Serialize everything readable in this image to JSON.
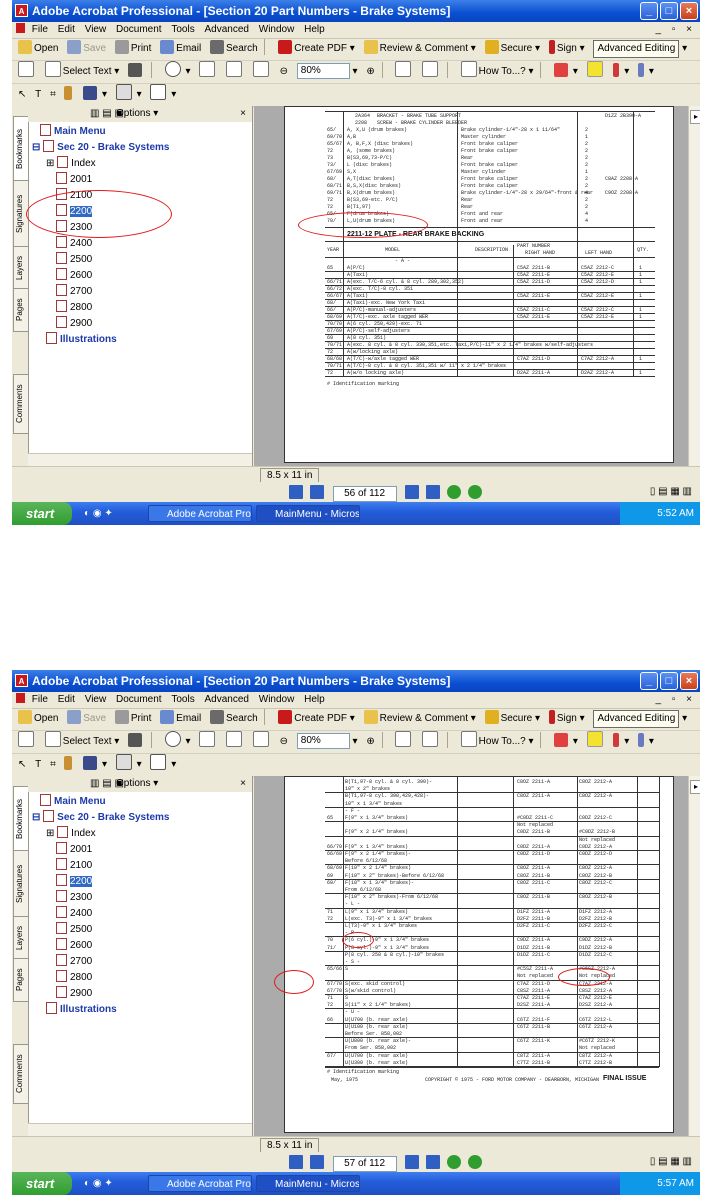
{
  "screens": [
    {
      "window_title": "Adobe Acrobat Professional - [Section 20 Part Numbers - Brake Systems]",
      "page_counter": "56 of 112",
      "clock": "5:52 AM",
      "selected_bookmark": "2200"
    },
    {
      "window_title": "Adobe Acrobat Professional - [Section 20 Part Numbers - Brake Systems]",
      "page_counter": "57 of 112",
      "clock": "5:57 AM",
      "selected_bookmark": "2200"
    }
  ],
  "menu": [
    "File",
    "Edit",
    "View",
    "Document",
    "Tools",
    "Advanced",
    "Window",
    "Help"
  ],
  "toolbar1": {
    "open": "Open",
    "save": "Save",
    "print": "Print",
    "email": "Email",
    "search": "Search",
    "create_pdf": "Create PDF",
    "review": "Review & Comment",
    "secure": "Secure",
    "sign": "Sign",
    "advanced_editing": "Advanced Editing"
  },
  "toolbar2": {
    "select_text": "Select Text",
    "zoom": "80%",
    "how_to": "How To...?"
  },
  "nav": {
    "options": "Options",
    "tabs": [
      "Bookmarks",
      "Signatures",
      "Layers",
      "Pages",
      "Comments"
    ],
    "bookmarks": [
      {
        "label": "Main Menu"
      },
      {
        "label": "Sec 20 - Brake Systems"
      },
      {
        "label": "Index"
      },
      {
        "label": "2001"
      },
      {
        "label": "2100"
      },
      {
        "label": "2200"
      },
      {
        "label": "2300"
      },
      {
        "label": "2400"
      },
      {
        "label": "2500"
      },
      {
        "label": "2600"
      },
      {
        "label": "2700"
      },
      {
        "label": "2800"
      },
      {
        "label": "2900"
      },
      {
        "label": "Illustrations"
      }
    ]
  },
  "page_size": "8.5 x 11 in",
  "taskbar": {
    "start": "start",
    "task1": "Adobe Acrobat Profe...",
    "task2": "MainMenu - Microsoft..."
  },
  "doc1": {
    "top_rows": [
      {
        "code": "2A364",
        "text": "BRACKET - BRAKE TUBE SUPPORT",
        "part": "D1ZZ 2B390-A"
      },
      {
        "code": "2208",
        "text": "SCREW - BRAKE CYLINDER BLEEDER"
      },
      {
        "year": "65/",
        "model": "A, X,U (drum brakes)",
        "desc": "Brake cylinder-1/4\"-28 x 1 11/64\"",
        "qty": "2"
      },
      {
        "year": "69/70",
        "model": "A,B",
        "desc": "Master cylinder",
        "qty": "1"
      },
      {
        "year": "65/67",
        "model": "A, B,F,X (disc brakes)",
        "desc": "Front brake caliper",
        "qty": "2"
      },
      {
        "year": "72",
        "model": "A, (some brakes)",
        "desc": "Front brake caliper",
        "qty": "2"
      },
      {
        "year": "73",
        "model": "B(S3,69,73-P/C)",
        "desc": "Rear",
        "qty": "2"
      },
      {
        "year": "73/",
        "model": "L (disc brakes)",
        "desc": "Front brake caliper",
        "qty": "2"
      },
      {
        "year": "67/69",
        "model": "S,X",
        "desc": "Master cylinder",
        "qty": "1"
      },
      {
        "year": "68/",
        "model": "A,T(disc brakes)",
        "desc": "Front brake caliper",
        "qty": "2",
        "part": "C8AZ 2208-A"
      },
      {
        "year": "68/71",
        "model": "B,S,X(disc brakes)",
        "desc": "Front brake caliper",
        "qty": "2"
      },
      {
        "year": "69/71",
        "model": "B,X(drum brakes)",
        "desc": "Brake cylinder-1/4\"-28 x 29/64\"-front & rear",
        "qty": "4",
        "part": "C9OZ 2208-A"
      },
      {
        "year": "72",
        "model": "B(S3,69-etc. P/C)",
        "desc": "Rear",
        "qty": "2"
      },
      {
        "year": "72",
        "model": "B(T1,97)",
        "desc": "Rear",
        "qty": "2"
      },
      {
        "year": "65/",
        "model": "F(drum brakes)",
        "desc": "Front and rear",
        "qty": "4"
      },
      {
        "year": "70/",
        "model": "L,U(drum brakes)",
        "desc": "Front and rear",
        "qty": "4"
      }
    ],
    "section_title": "2211-12  PLATE - REAR BRAKE BACKING",
    "headers": {
      "year": "YEAR",
      "model": "MODEL",
      "description": "DESCRIPTION",
      "part_number": "PART NUMBER",
      "right_hand": "RIGHT HAND",
      "left_hand": "LEFT HAND",
      "qty": "QTY."
    },
    "group": "- A -",
    "rows": [
      {
        "year": "65",
        "model": "A(P/C)",
        "rh": "C5AZ  2211-B",
        "lh": "C5AZ  2212-C",
        "qty": "1"
      },
      {
        "year": "",
        "model": "A(Taxi)",
        "rh": "C5AZ  2211-E",
        "lh": "C5AZ  2212-E",
        "qty": "1"
      },
      {
        "year": "66/71",
        "model": "A(exc. T/C-6 cyl. & 8 cyl. 289,302,352)",
        "rh": "C5AZ  2211-D",
        "lh": "C5AZ  2212-D",
        "qty": "1"
      },
      {
        "year": "66/72",
        "model": "A(exc. T/C)-8 cyl. 351",
        "rh": "",
        "lh": "",
        "qty": ""
      },
      {
        "year": "66/67",
        "model": "A(Taxi)",
        "rh": "C5AZ  2211-E",
        "lh": "C5AZ  2212-E",
        "qty": "1"
      },
      {
        "year": "68/",
        "model": "A(Taxi)-exc. New York Taxi",
        "rh": "",
        "lh": "",
        "qty": ""
      },
      {
        "year": "66/",
        "model": "A(P/C)-manual-adjusters",
        "rh": "C5AZ  2211-C",
        "lh": "C5AZ  2212-C",
        "qty": "1"
      },
      {
        "year": "68/69",
        "model": "A(T/C)-exc. axle tagged WER",
        "rh": "C5AZ  2211-E",
        "lh": "C5AZ  2212-E",
        "qty": "1"
      },
      {
        "year": "70/70",
        "model": "A(6 cyl. 250,429)-exc. 71",
        "rh": "",
        "lh": "",
        "qty": ""
      },
      {
        "year": "67/69",
        "model": "A(P/C)-self-adjusters",
        "rh": "",
        "lh": "",
        "qty": ""
      },
      {
        "year": "69",
        "model": "A(8 cyl. 351)",
        "rh": "",
        "lh": "",
        "qty": ""
      },
      {
        "year": "70/71",
        "model": "A(exc. 8 cyl. & 8 cyl. 330,351,etc. Taxi,P/C)-11\" x 2 1/4\" brakes w/self-adjusters",
        "rh": "",
        "lh": "",
        "qty": ""
      },
      {
        "year": "72",
        "model": "A(w/locking axle)",
        "rh": "",
        "lh": "",
        "qty": ""
      },
      {
        "year": "68/68",
        "model": "A(T/C)-w/axle tagged WER",
        "rh": "C7AZ  2211-D",
        "lh": "C7AZ  2212-A",
        "qty": "1"
      },
      {
        "year": "70/71",
        "model": "A(T/C)-8 cyl. & 8 cyl. 351,351 w/ 11\" x 2 1/4\" brakes",
        "rh": "",
        "lh": "",
        "qty": ""
      },
      {
        "year": "72",
        "model": "A(w/o locking axle)",
        "rh": "D2AZ  2211-A",
        "lh": "D2AZ  2212-A",
        "qty": "1"
      }
    ],
    "footnote": "# Identification marking"
  },
  "doc2": {
    "rows": [
      {
        "year": "",
        "model": "B(T1,97-8 cyl. & 8 cyl. 390)-",
        "rh": "C8OZ  2211-A",
        "lh": "C8OZ  2212-A"
      },
      {
        "year": "",
        "model": "10\" x 2\" brakes",
        "rh": "",
        "lh": ""
      },
      {
        "year": "",
        "model": "B(T1,97-8 cyl. 390,429,428)-",
        "rh": "C8OZ  2211-A",
        "lh": "C8OZ  2212-A"
      },
      {
        "year": "",
        "model": "10\" x 1 3/4\" brakes",
        "rh": "",
        "lh": ""
      },
      {
        "year": "",
        "model": "- F -",
        "rh": "",
        "lh": ""
      },
      {
        "year": "65",
        "model": "F(9\" x 1 3/4\" brakes)",
        "rh": "#C0DZ  2211-C",
        "lh": "C0DZ  2212-C"
      },
      {
        "year": "",
        "model": "",
        "rh": "Not replaced",
        "lh": ""
      },
      {
        "year": "",
        "model": "F(9\" x 2 1/4\" brakes)",
        "rh": "C0DZ  2211-B",
        "lh": "#C0DZ  2212-B"
      },
      {
        "year": "",
        "model": "",
        "rh": "",
        "lh": "Not replaced"
      },
      {
        "year": "66/70",
        "model": "F(9\" x 1 3/4\" brakes)",
        "rh": "C0DZ  2211-A",
        "lh": "C0DZ  2212-A"
      },
      {
        "year": "66/69",
        "model": "F(9\" x 2 1/4\" brakes)-",
        "rh": "C0DZ  2211-D",
        "lh": "C0DZ  2212-D"
      },
      {
        "year": "",
        "model": "Before 6/12/68",
        "rh": "",
        "lh": ""
      },
      {
        "year": "68/69",
        "model": "F(10\" x 2 1/4\" brakes)",
        "rh": "C8OZ  2211-A",
        "lh": "C8OZ  2212-A"
      },
      {
        "year": "69",
        "model": "F(10\" x 2\" brakes)-Before 6/12/68",
        "rh": "C8OZ  2211-B",
        "lh": "C8OZ  2212-B"
      },
      {
        "year": "69/",
        "model": "F(10\" x 1 3/4\" brakes)-",
        "rh": "C8OZ  2211-C",
        "lh": "C8OZ  2212-C"
      },
      {
        "year": "",
        "model": "From 6/12/68",
        "rh": "",
        "lh": ""
      },
      {
        "year": "",
        "model": "F(10\" x 2\" brakes)-From 6/12/68",
        "rh": "C8OZ  2211-B",
        "lh": "C8OZ  2212-B"
      },
      {
        "year": "",
        "model": "- L -",
        "rh": "",
        "lh": ""
      },
      {
        "year": "71",
        "model": "L(9\" x 1 3/4\" brakes)",
        "rh": "D1FZ  2211-A",
        "lh": "D1FZ  2212-A"
      },
      {
        "year": "72",
        "model": "L(exc. T3)-9\" x 1 3/4\" brakes",
        "rh": "D2FZ  2211-B",
        "lh": "D2FZ  2212-B"
      },
      {
        "year": "",
        "model": "L(T3)-9\" x 1 3/4\" brakes",
        "rh": "D2FZ  2211-C",
        "lh": "D2FZ  2212-C"
      },
      {
        "year": "",
        "model": "- P -",
        "rh": "",
        "lh": ""
      },
      {
        "year": "70",
        "model": "P(6 cyl.)-9\" x 1 3/4\" brakes",
        "rh": "C9DZ  2211-A",
        "lh": "C9DZ  2212-A"
      },
      {
        "year": "71/",
        "model": "P(8 cyl.)-9\" x 1 3/4\" brakes",
        "rh": "D1DZ  2211-B",
        "lh": "D1DZ  2212-B"
      },
      {
        "year": "",
        "model": "P(8 cyl. 250 & 8 cyl.)-10\" brakes",
        "rh": "D1DZ  2211-C",
        "lh": "D1DZ  2212-C"
      },
      {
        "year": "",
        "model": "- S -",
        "rh": "",
        "lh": ""
      },
      {
        "year": "65/66",
        "model": "S",
        "rh": "#C5SZ  2211-A",
        "lh": "#C5SZ  2212-A"
      },
      {
        "year": "",
        "model": "",
        "rh": "Not replaced",
        "lh": "Not replaced"
      },
      {
        "year": "67/70",
        "model": "S(exc. skid control)",
        "rh": "C7AZ  2211-D",
        "lh": "C7AZ  2212-A"
      },
      {
        "year": "67/70",
        "model": "S(w/skid control)",
        "rh": "C8SZ  2211-A",
        "lh": "C8SZ  2212-A"
      },
      {
        "year": "71",
        "model": "S",
        "rh": "C7AZ  2211-E",
        "lh": "C7AZ  2212-E"
      },
      {
        "year": "72",
        "model": "S(11\" x 2 1/4\" brakes)",
        "rh": "D2SZ  2211-A",
        "lh": "D2SZ  2212-A"
      },
      {
        "year": "",
        "model": "- U -",
        "rh": "",
        "lh": ""
      },
      {
        "year": "66",
        "model": "U(U700 (b. rear axle)",
        "rh": "C6TZ  2211-F",
        "lh": "C6TZ  2212-L"
      },
      {
        "year": "",
        "model": "U(U100 (b. rear axle)",
        "rh": "C6TZ  2211-B",
        "lh": "C6TZ  2212-A"
      },
      {
        "year": "",
        "model": "Before Ser. 858,002",
        "rh": "",
        "lh": ""
      },
      {
        "year": "",
        "model": "U(U800 (b. rear axle)-",
        "rh": "C6TZ  2211-K",
        "lh": "#C6TZ  2212-K"
      },
      {
        "year": "",
        "model": "From Ser. 858,002",
        "rh": "",
        "lh": "Not replaced"
      },
      {
        "year": "67/",
        "model": "U(U700 (b. rear axle)",
        "rh": "C8TZ  2211-A",
        "lh": "C8TZ  2212-A"
      },
      {
        "year": "",
        "model": "U(U300 (b. rear axle)",
        "rh": "C7TZ  2211-B",
        "lh": "C7TZ  2212-B"
      }
    ],
    "footnote": "# Identification marking",
    "date": "May, 1975",
    "copyright": "COPYRIGHT © 1975 -   FORD MOTOR COMPANY   - DEARBORN, MICHIGAN",
    "final": "FINAL ISSUE"
  },
  "colors": {
    "titlebar": "#0a4fd2",
    "annotation": "#e21a1a",
    "selection": "#316ac5",
    "taskbar": "#245edb"
  }
}
